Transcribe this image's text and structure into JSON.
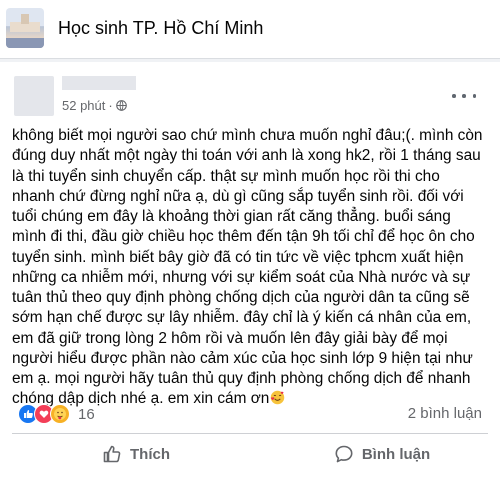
{
  "group": {
    "name": "Học sinh TP. Hồ Chí Minh"
  },
  "post": {
    "time": "52 phút",
    "lines": [
      "không biết mọi người sao chứ mình chưa muốn nghỉ đâu;(. mình còn",
      "đúng duy nhất một ngày thi toán với anh là xong hk2, rồi 1 tháng sau",
      "là thi tuyển sinh chuyển cấp. thật sự mình muốn học rồi thi cho",
      "nhanh chứ đừng nghỉ nữa ạ, dù gì cũng sắp tuyển sinh rồi. đối với",
      "tuổi chúng em đây là khoảng thời gian rất căng thẳng. buổi sáng",
      "mình đi thi, đầu giờ chiều học thêm đến tận 9h tối chỉ để học ôn cho",
      "tuyển sinh. mình biết bây giờ đã có tin tức về việc tphcm xuất hiện",
      "những ca nhiễm mới, nhưng với sự kiểm soát của Nhà nước và sự",
      "tuân thủ theo quy định phòng chống dịch của người dân ta cũng sẽ",
      "sớm hạn chế được sự lây nhiễm. đây chỉ là ý kiến cá nhân của em,",
      "em đã giữ trong lòng 2 hôm rồi và muốn lên đây giải bày để mọi",
      "người hiểu được phần nào cảm xúc của học sinh lớp 9 hiện tại như",
      "em ạ. mọi người hãy tuân thủ quy định phòng chống dịch để nhanh",
      "chóng dập dịch nhé ạ. em xin cám ơn"
    ],
    "end_emoji": "smiling-face-with-hearts-emoji",
    "reaction_count": "16",
    "comments": "2 bình luận"
  },
  "actions": {
    "like": "Thích",
    "comment": "Bình luận"
  },
  "colors": {
    "like": "#1877f2",
    "love": "#f33e58",
    "care": "#f7b125",
    "secondary_text": "#65676b"
  }
}
